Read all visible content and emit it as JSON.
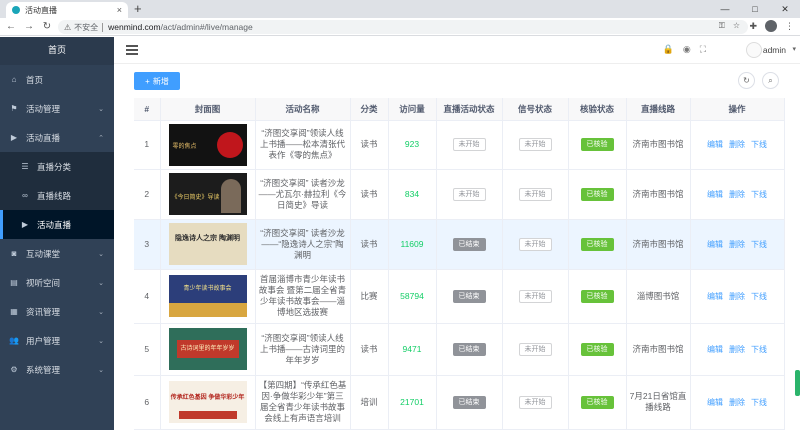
{
  "browser": {
    "tab_title": "活动直播",
    "tab_close": "×",
    "new_tab": "+",
    "insecure_label": "不安全",
    "url_host": "wenmind.com",
    "url_path": "/act/admin#/live/manage"
  },
  "sidebar": {
    "title": "首页",
    "items": [
      {
        "label": "首页",
        "icon": "home-icon"
      },
      {
        "label": "活动管理",
        "icon": "flag-icon"
      },
      {
        "label": "活动直播",
        "icon": "video-icon"
      },
      {
        "label": "直播分类",
        "icon": "list-icon"
      },
      {
        "label": "直播线路",
        "icon": "link-icon"
      },
      {
        "label": "活动直播",
        "icon": "video-icon"
      },
      {
        "label": "互动课堂",
        "icon": "camera-icon"
      },
      {
        "label": "视听空间",
        "icon": "film-icon"
      },
      {
        "label": "资讯管理",
        "icon": "grid-icon"
      },
      {
        "label": "用户管理",
        "icon": "users-icon"
      },
      {
        "label": "系统管理",
        "icon": "gears-icon"
      }
    ]
  },
  "header": {
    "user_name": "admin"
  },
  "toolbar": {
    "add_label": "新增"
  },
  "table": {
    "headers": [
      "#",
      "封面图",
      "活动名称",
      "分类",
      "访问量",
      "直播活动状态",
      "信号状态",
      "核验状态",
      "直播线路",
      "操作"
    ],
    "actions": [
      "编辑",
      "删除",
      "下线"
    ],
    "rows": [
      {
        "index": "1",
        "name": "“济图交享阅”领读人线上书播——松本清张代表作《零的焦点》",
        "category": "读书",
        "visits": "923",
        "live_status": "未开始",
        "signal": "未开始",
        "verify": "已核验",
        "route": "济南市图书馆",
        "cover_text": "零的焦点"
      },
      {
        "index": "2",
        "name": "“济图交享阅” 读者沙龙——尤瓦尔·赫拉利《今日简史》导读",
        "category": "读书",
        "visits": "834",
        "live_status": "未开始",
        "signal": "未开始",
        "verify": "已核验",
        "route": "济南市图书馆",
        "cover_text": "《今日简史》导读"
      },
      {
        "index": "3",
        "name": "“济图交享阅” 读者沙龙——“隐逸诗人之宗”陶渊明",
        "category": "读书",
        "visits": "11609",
        "live_status": "已结束",
        "signal": "未开始",
        "verify": "已核验",
        "route": "济南市图书馆",
        "cover_text": "隐逸诗人之宗 陶渊明"
      },
      {
        "index": "4",
        "name": "首届淄博市青少年读书故事会 暨第二届全省青少年读书故事会——淄博地区选拔赛",
        "category": "比赛",
        "visits": "58794",
        "live_status": "已结束",
        "signal": "未开始",
        "verify": "已核验",
        "route": "淄博图书馆",
        "cover_text": "青少年读书故事会"
      },
      {
        "index": "5",
        "name": "“济图交享阅”领读人线上书播——古诗词里的年年岁岁",
        "category": "读书",
        "visits": "9471",
        "live_status": "已结束",
        "signal": "未开始",
        "verify": "已核验",
        "route": "济南市图书馆",
        "cover_text": "古诗词里的年年岁岁"
      },
      {
        "index": "6",
        "name": "【第四期】“传承红色基因·争做华彩少年”第三届全省青少年读书故事会线上有声语言培训",
        "category": "培训",
        "visits": "21701",
        "live_status": "已结束",
        "signal": "未开始",
        "verify": "已核验",
        "route": "7月21日省馆直播线路",
        "cover_text": "传承红色基因 争做华彩少年"
      }
    ]
  }
}
